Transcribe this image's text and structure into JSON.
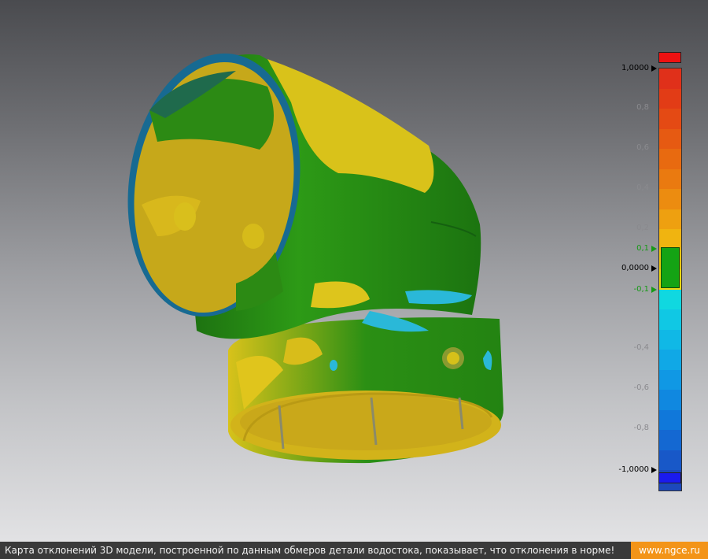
{
  "legend": {
    "max_label": "1,0000",
    "zero_label": "0,0000",
    "min_label": "-1,0000",
    "ticks": [
      "0,8",
      "0,6",
      "0,4",
      "0,2",
      "-0,4",
      "-0,6",
      "-0,8"
    ],
    "tolerance_upper": "0,1",
    "tolerance_lower": "-0,1",
    "over_color": "#ee1111",
    "under_color": "#1a1aee",
    "tolerance_color": "#14a314",
    "bands": [
      "#e0301a",
      "#e23c16",
      "#e44a14",
      "#e65a12",
      "#e86a10",
      "#ea7a10",
      "#ec8c10",
      "#eea010",
      "#f0b410",
      "#f2c610",
      "#f2d80e",
      "#10d8e0",
      "#10c8e4",
      "#10b8e6",
      "#10a8e6",
      "#1098e4",
      "#1088e0",
      "#1078da",
      "#1468d2",
      "#1858c8",
      "#1c48bc"
    ]
  },
  "footer": {
    "caption": "Карта отклонений 3D модели, построенной по данным обмеров детали водостока, показывает, что отклонения в норме!",
    "site": "www.ngce.ru"
  }
}
